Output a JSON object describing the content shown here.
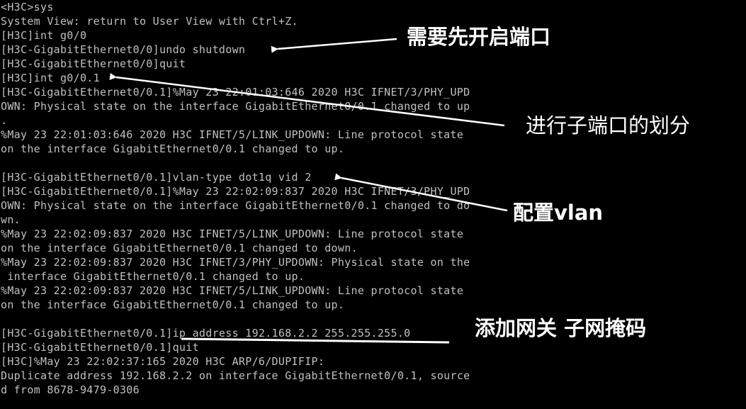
{
  "terminal": {
    "lines": [
      "<H3C>sys",
      "System View: return to User View with Ctrl+Z.",
      "[H3C]int g0/0",
      "[H3C-GigabitEthernet0/0]undo shutdown",
      "[H3C-GigabitEthernet0/0]quit",
      "[H3C]int g0/0.1",
      "[H3C-GigabitEthernet0/0.1]%May 23 22:01:03:646 2020 H3C IFNET/3/PHY_UPD",
      "OWN: Physical state on the interface GigabitEthernet0/0.1 changed to up",
      ".",
      "%May 23 22:01:03:646 2020 H3C IFNET/5/LINK_UPDOWN: Line protocol state",
      "on the interface GigabitEthernet0/0.1 changed to up.",
      "",
      "[H3C-GigabitEthernet0/0.1]vlan-type dot1q vid 2",
      "[H3C-GigabitEthernet0/0.1]%May 23 22:02:09:837 2020 H3C IFNET/3/PHY_UPD",
      "OWN: Physical state on the interface GigabitEthernet0/0.1 changed to do",
      "wn.",
      "%May 23 22:02:09:837 2020 H3C IFNET/5/LINK_UPDOWN: Line protocol state",
      "on the interface GigabitEthernet0/0.1 changed to down.",
      "%May 23 22:02:09:837 2020 H3C IFNET/3/PHY_UPDOWN: Physical state on the",
      " interface GigabitEthernet0/0.1 changed to up.",
      "%May 23 22:02:09:837 2020 H3C IFNET/5/LINK_UPDOWN: Line protocol state",
      "on the interface GigabitEthernet0/0.1 changed to up.",
      "",
      "[H3C-GigabitEthernet0/0.1]ip address 192.168.2.2 255.255.255.0",
      "[H3C-GigabitEthernet0/0.1]quit",
      "[H3C]%May 23 22:02:37:165 2020 H3C ARP/6/DUPIFIP:",
      "Duplicate address 192.168.2.2 on interface GigabitEthernet0/0.1, source",
      "d from 8678-9479-0306"
    ]
  },
  "annotations": {
    "enable_port": "需要先开启端口",
    "subinterface": "进行子端口的划分",
    "config_vlan": "配置vlan",
    "gateway_mask": "添加网关 子网掩码"
  },
  "colors": {
    "background": "#000000",
    "terminal_text": "#c0c0c0",
    "annotation": "#ffffff"
  }
}
